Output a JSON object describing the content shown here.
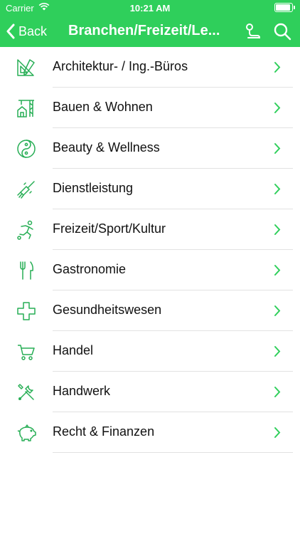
{
  "status_bar": {
    "carrier": "Carrier",
    "time": "10:21 AM"
  },
  "nav": {
    "back_label": "Back",
    "title": "Branchen/Freizeit/Le..."
  },
  "colors": {
    "accent": "#2fcf5b",
    "icon_green": "#27ae55",
    "chevron": "#2fcf5b"
  },
  "items": [
    {
      "label": "Architektur- / Ing.-Büros",
      "icon": "architecture-pencil-icon"
    },
    {
      "label": "Bauen & Wohnen",
      "icon": "crane-house-icon"
    },
    {
      "label": "Beauty & Wellness",
      "icon": "yin-yang-icon"
    },
    {
      "label": "Dienstleistung",
      "icon": "brush-icon"
    },
    {
      "label": "Freizeit/Sport/Kultur",
      "icon": "sport-runner-icon"
    },
    {
      "label": "Gastronomie",
      "icon": "fork-knife-icon"
    },
    {
      "label": "Gesundheitswesen",
      "icon": "medical-cross-icon"
    },
    {
      "label": "Handel",
      "icon": "shopping-cart-icon"
    },
    {
      "label": "Handwerk",
      "icon": "tools-icon"
    },
    {
      "label": "Recht & Finanzen",
      "icon": "piggy-bank-icon"
    }
  ]
}
